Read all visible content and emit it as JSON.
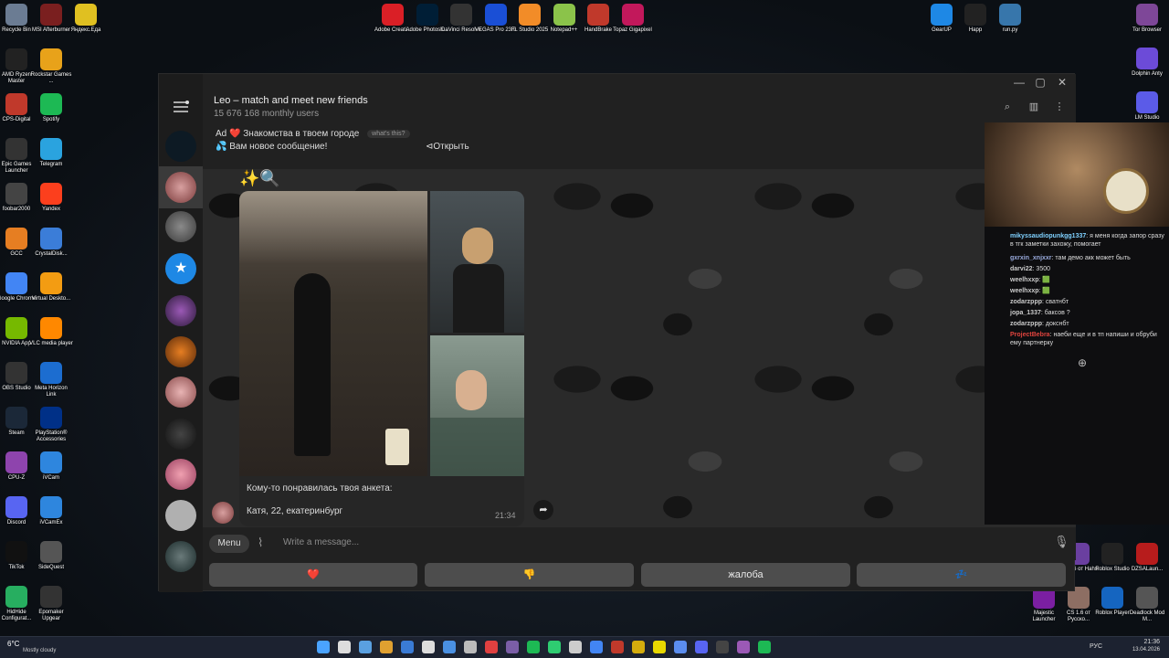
{
  "desktop_icons": [
    {
      "label": "Recycle Bin",
      "color": "#6b7c93"
    },
    {
      "label": "MSI Afterburner",
      "color": "#7a1f1f"
    },
    {
      "label": "Яндекс.Еда",
      "color": "#e0c021"
    },
    {
      "label": "AMD Ryzen Master",
      "color": "#222"
    },
    {
      "label": "Rockstar Games ...",
      "color": "#e8a21a"
    },
    {
      "label": "CPS-Digital",
      "color": "#c0392b"
    },
    {
      "label": "Spotify",
      "color": "#1db954"
    },
    {
      "label": "Epic Games Launcher",
      "color": "#333"
    },
    {
      "label": "Telegram",
      "color": "#2aa3df"
    },
    {
      "label": "foobar2000",
      "color": "#444"
    },
    {
      "label": "Yandex",
      "color": "#fc3f1d"
    },
    {
      "label": "GCC",
      "color": "#e67e22"
    },
    {
      "label": "CrystalDisk...",
      "color": "#3b7dd8"
    },
    {
      "label": "Google Chrome",
      "color": "#4285f4"
    },
    {
      "label": "Virtual Deskto...",
      "color": "#f39c12"
    },
    {
      "label": "NVIDIA App",
      "color": "#76b900"
    },
    {
      "label": "VLC media player",
      "color": "#ff8800"
    },
    {
      "label": "OBS Studio",
      "color": "#333"
    },
    {
      "label": "Meta Horizon Link",
      "color": "#1c6dd0"
    },
    {
      "label": "Steam",
      "color": "#1b2838"
    },
    {
      "label": "PlayStation® Accessories",
      "color": "#003087"
    },
    {
      "label": "CPU-Z",
      "color": "#8e44ad"
    },
    {
      "label": "iVCam",
      "color": "#2e86de"
    },
    {
      "label": "Discord",
      "color": "#5865f2"
    },
    {
      "label": "iVCamEx",
      "color": "#2e86de"
    },
    {
      "label": "TikTok",
      "color": "#111"
    },
    {
      "label": "SideQuest",
      "color": "#555"
    },
    {
      "label": "HidHide Configurat...",
      "color": "#27ae60"
    },
    {
      "label": "Epomaker Upgear",
      "color": "#333"
    }
  ],
  "top_icons": [
    {
      "label": "Adobe Creati...",
      "color": "#da1f26"
    },
    {
      "label": "Adobe Photosh...",
      "color": "#001e36"
    },
    {
      "label": "DaVinci Resolve",
      "color": "#333"
    },
    {
      "label": "VEGAS Pro 23.0",
      "color": "#1a4fd6"
    },
    {
      "label": "FL Studio 2025",
      "color": "#f28c28"
    },
    {
      "label": "Notepad++",
      "color": "#8bc34a"
    },
    {
      "label": "HandBrake",
      "color": "#c0392b"
    },
    {
      "label": "Topaz Gigapixel",
      "color": "#c2185b"
    }
  ],
  "right_icons": [
    {
      "label": "GearUP",
      "color": "#1e88e5"
    },
    {
      "label": "Happ",
      "color": "#222"
    },
    {
      "label": "run.py",
      "color": "#3776ab"
    },
    {
      "label": "Tor Browser",
      "color": "#7e4798"
    },
    {
      "label": "Dolphin Anty",
      "color": "#6c4bd8"
    },
    {
      "label": "LM Studio",
      "color": "#5b5be8"
    }
  ],
  "bottom_right_icons": [
    {
      "label": "CS 1.6 от Hahs",
      "color": "#6a3fa0"
    },
    {
      "label": "Roblox Studio",
      "color": "#222"
    },
    {
      "label": "DZSALaun...",
      "color": "#b71c1c"
    },
    {
      "label": "Majestic Launcher",
      "color": "#7b1fa2"
    },
    {
      "label": "CS 1.6 от Русско...",
      "color": "#8d6e63"
    },
    {
      "label": "Roblox Player",
      "color": "#1565c0"
    },
    {
      "label": "Deadlock Mod M...",
      "color": "#555"
    }
  ],
  "telegram": {
    "chat_title": "Leo – match and meet new friends",
    "chat_subtitle": "15 676 168 monthly users",
    "ad_label": "Ad",
    "ad_heart": "❤️",
    "ad_title": "Знакомства в твоем городе",
    "ad_whats": "what's this?",
    "ad_text": "💦 Вам новое сообщение!",
    "ad_open": "Открыть",
    "message_emoji": "✨🔍",
    "message_caption": "Кому-то понравилась твоя анкета:",
    "card_name": "Катя, 22, екатеринбург",
    "card_time": "21:34",
    "menu_label": "Menu",
    "input_placeholder": "Write a message...",
    "keyboard": [
      "❤️",
      "👎",
      "жалоба",
      "💤"
    ]
  },
  "stream_chat": [
    {
      "user": "mikyssaudiopunkgg1337",
      "color": "#7fd1ff",
      "text": "я меня когда запор сразу в тгк заметки захожу, помогает"
    },
    {
      "user": "gxrxin_xnjxxr",
      "color": "#9ad",
      "text": "там демо акк может быть"
    },
    {
      "user": "darvi22",
      "color": "#ccc",
      "text": "3500"
    },
    {
      "user": "weelhxxp",
      "color": "#ccc",
      "text": "🟩"
    },
    {
      "user": "weelhxxp",
      "color": "#ccc",
      "text": "🟩"
    },
    {
      "user": "zodarzppp",
      "color": "#ccc",
      "text": "сватнбт"
    },
    {
      "user": "jopa_1337",
      "color": "#ccc",
      "text": "баксов ?"
    },
    {
      "user": "zodarzppp",
      "color": "#ccc",
      "text": "докснбт"
    },
    {
      "user": "ProjectBebra",
      "color": "#e0443e",
      "text": "наеби еще и в тп напиши и обруби ему партнерку"
    }
  ],
  "taskbar": {
    "weather_temp": "6°C",
    "weather_text": "Mostly cloudy",
    "lang": "РУС",
    "time": "21:36",
    "date": "13.04.2026"
  }
}
